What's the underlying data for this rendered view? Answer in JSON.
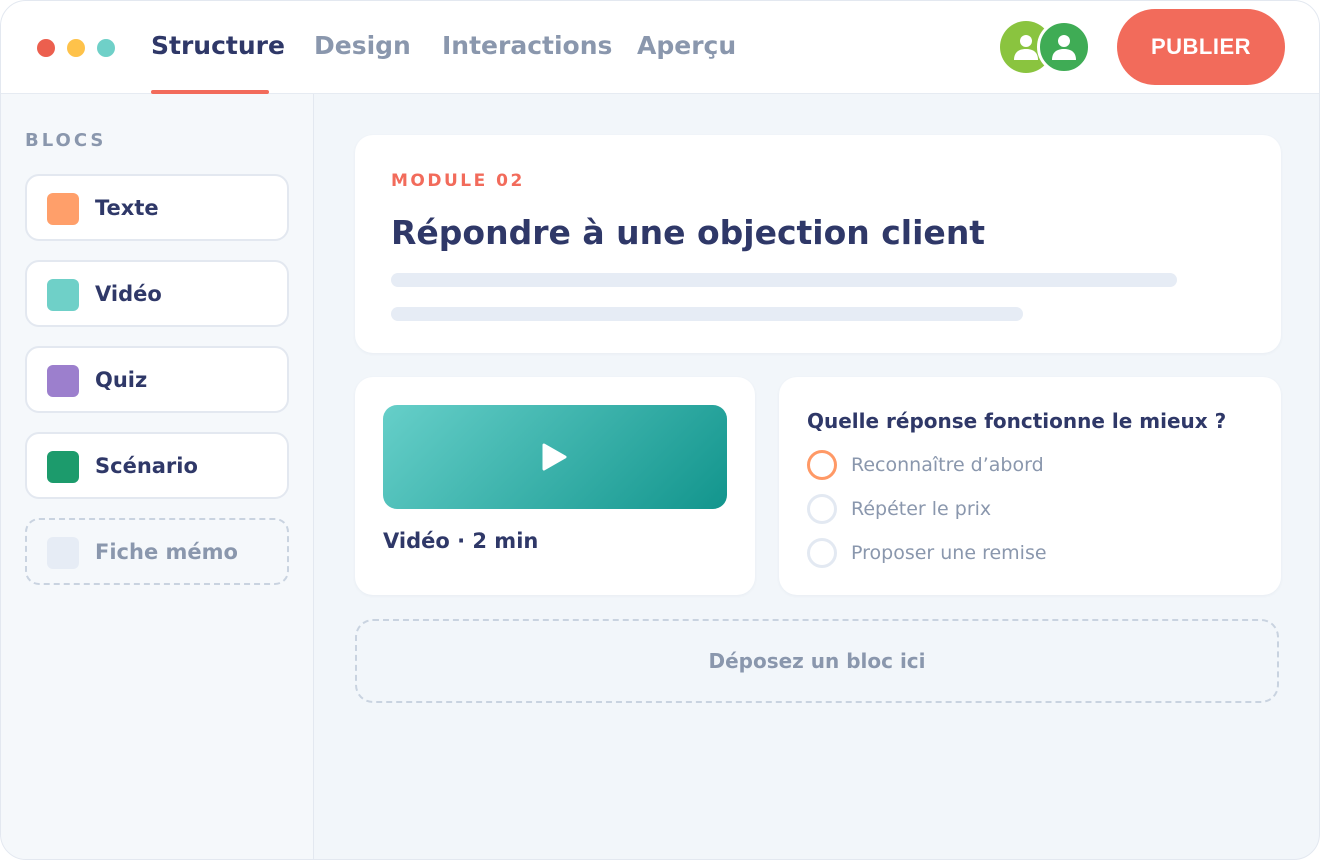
{
  "window": {
    "controls": [
      {
        "name": "close",
        "color": "#ec5f4e"
      },
      {
        "name": "minimize",
        "color": "#fec24a"
      },
      {
        "name": "maximize",
        "color": "#6fd0c8"
      }
    ]
  },
  "tabs": [
    {
      "label": "Structure",
      "active": true
    },
    {
      "label": "Design",
      "active": false
    },
    {
      "label": "Interactions",
      "active": false
    },
    {
      "label": "Aperçu",
      "active": false
    }
  ],
  "collaborators": [
    {
      "icon": "user-icon",
      "color": "#8ac43f"
    },
    {
      "icon": "user-icon",
      "color": "#3fac55"
    }
  ],
  "publish_button": {
    "label": "PUBLIER",
    "color": "#f26b5b"
  },
  "sidebar": {
    "heading": "BLOCS",
    "blocks": [
      {
        "label": "Texte",
        "color": "#ff9f6a"
      },
      {
        "label": "Vidéo",
        "color": "#6fd0c8"
      },
      {
        "label": "Quiz",
        "color": "#9c7fcd"
      },
      {
        "label": "Scénario",
        "color": "#1c9b6c"
      },
      {
        "label": "Fiche mémo",
        "color": "#e6ecf5",
        "placeholder": true
      }
    ]
  },
  "module": {
    "label": "MODULE 02",
    "title": "Répondre à une objection client"
  },
  "video_card": {
    "icon": "play-icon",
    "caption": "Vidéo · 2 min"
  },
  "quiz_card": {
    "question": "Quelle réponse fonctionne le mieux ?",
    "options": [
      {
        "label": "Reconnaître d’abord",
        "selected": true
      },
      {
        "label": "Répéter le prix",
        "selected": false
      },
      {
        "label": "Proposer une remise",
        "selected": false
      }
    ]
  },
  "dropzone": {
    "label": "Déposez un bloc ici"
  },
  "colors": {
    "accent": "#f26b5b",
    "text_dark": "#2f3868",
    "text_muted": "#8a97ad",
    "quiz_selected": "#ff9966"
  }
}
